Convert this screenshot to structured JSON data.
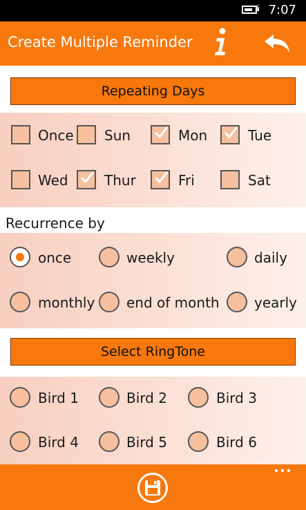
{
  "status_bar": {
    "time": "7:07",
    "battery_icon": "battery-charging-icon"
  },
  "header": {
    "title": "Create Multiple Reminder",
    "info_icon": "info-icon",
    "back_icon": "back-arrow-icon"
  },
  "repeating_days": {
    "button_label": "Repeating Days",
    "days": [
      {
        "label": "Once",
        "checked": false
      },
      {
        "label": "Sun",
        "checked": false
      },
      {
        "label": "Mon",
        "checked": true
      },
      {
        "label": "Tue",
        "checked": true
      },
      {
        "label": "Wed",
        "checked": false
      },
      {
        "label": "Thur",
        "checked": true
      },
      {
        "label": "Fri",
        "checked": true
      },
      {
        "label": "Sat",
        "checked": false
      }
    ]
  },
  "recurrence": {
    "label": "Recurrence by",
    "options": [
      {
        "label": "once",
        "selected": true
      },
      {
        "label": "weekly",
        "selected": false
      },
      {
        "label": "daily",
        "selected": false
      },
      {
        "label": "monthly",
        "selected": false
      },
      {
        "label": "end of month",
        "selected": false
      },
      {
        "label": "yearly",
        "selected": false
      }
    ]
  },
  "ringtone": {
    "button_label": "Select RingTone",
    "options": [
      {
        "label": "Bird 1",
        "selected": false
      },
      {
        "label": "Bird 2",
        "selected": false
      },
      {
        "label": "Bird 3",
        "selected": false
      },
      {
        "label": "Bird 4",
        "selected": false
      },
      {
        "label": "Bird 5",
        "selected": false
      },
      {
        "label": "Bird 6",
        "selected": false
      }
    ]
  },
  "app_bar_bottom": {
    "save_icon": "floppy-disk-icon",
    "more_icon": "ellipsis-icon"
  },
  "colors": {
    "accent": "#f7780d",
    "panel_start": "#f8cfc0",
    "panel_end": "#fdf1eb",
    "control_fill": "#f6c09f"
  }
}
